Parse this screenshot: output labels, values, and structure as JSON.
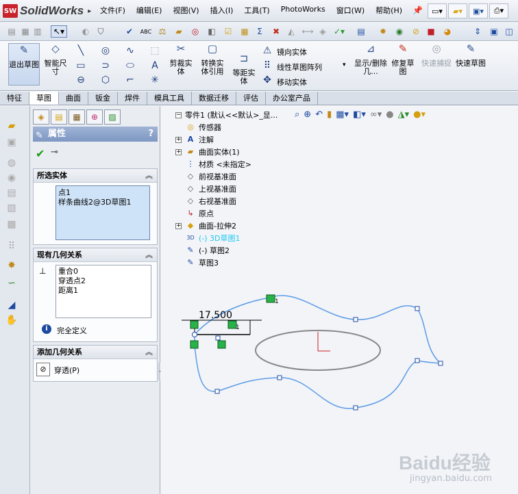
{
  "app": {
    "logo_text": "SolidWorks",
    "logo_badge": "SW"
  },
  "menu": [
    "文件(F)",
    "编辑(E)",
    "视图(V)",
    "插入(I)",
    "工具(T)",
    "PhotoWorks",
    "窗口(W)",
    "帮助(H)"
  ],
  "ribbon": {
    "exit_sketch": "退出草图",
    "smart_dim": "智能尺寸",
    "trim": "剪裁实体",
    "convert": "转换实体引用",
    "offset": "等距实体",
    "mirror": "镜向实体",
    "linear_pattern": "线性草图阵列",
    "move": "移动实体",
    "show_delete_rel": "显示/删除几...",
    "repair": "修复草图",
    "quick_snap": "快速捕捉",
    "rapid_sketch": "快速草图"
  },
  "tabs": [
    "特征",
    "草图",
    "曲面",
    "钣金",
    "焊件",
    "模具工具",
    "数据迁移",
    "评估",
    "办公室产品"
  ],
  "active_tab": "草图",
  "pm": {
    "title": "属性",
    "help": "?",
    "selected_entities_title": "所选实体",
    "selected_entities": [
      "点1",
      "样条曲线2@3D草图1"
    ],
    "existing_relations_title": "现有几何关系",
    "existing_relations": [
      "重合0",
      "穿透点2",
      "距离1"
    ],
    "status": "完全定义",
    "add_relations_title": "添加几何关系",
    "add_relation_item": "穿透(P)"
  },
  "tree": {
    "root": "零件1 (默认<<默认>_显...",
    "items": [
      "传感器",
      "注解",
      "曲面实体(1)",
      "材质 <未指定>",
      "前视基准面",
      "上视基准面",
      "右视基准面",
      "原点",
      "曲面-拉伸2",
      "(-) 3D草图1",
      "(-) 草图2",
      "草图3"
    ]
  },
  "sketch": {
    "dimension": "17.500",
    "label_1": "1",
    "label_2": "1"
  },
  "colors": {
    "spline": "#5b9be6",
    "highlight": "#1ec8f0",
    "relation_green": "#2ab24a"
  },
  "watermark": {
    "main": "Baidu经验",
    "sub": "jingyan.baidu.com"
  }
}
